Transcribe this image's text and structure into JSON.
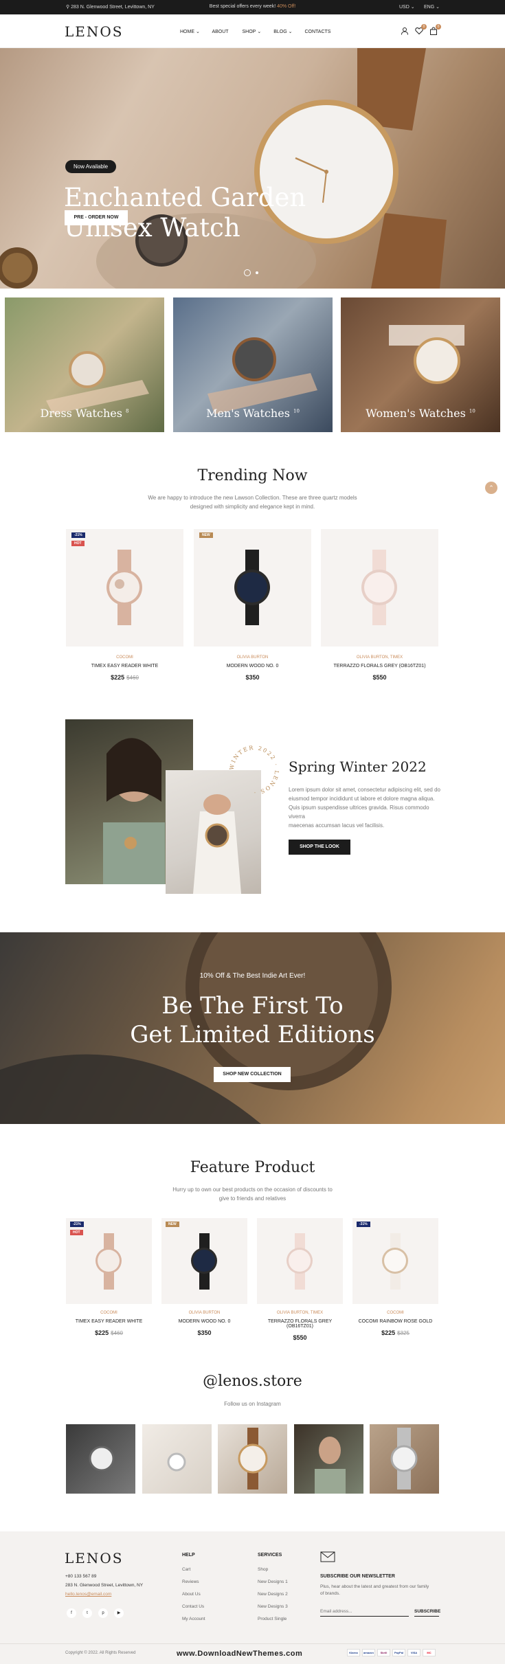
{
  "topbar": {
    "address": "283 N. Glenwood Street, Levittown, NY",
    "promo_prefix": "Best special offers every week!",
    "promo_highlight": "40% Off!",
    "currency": "USD",
    "language": "ENG"
  },
  "header": {
    "logo": "LENOS",
    "nav": [
      "HOME",
      "ABOUT",
      "SHOP",
      "BLOG",
      "CONTACTS"
    ],
    "wishlist_count": "0",
    "cart_count": "0"
  },
  "hero": {
    "badge": "Now Available",
    "title_line1": "Enchanted Garden",
    "title_line2": "Unisex Watch",
    "cta": "PRE - ORDER NOW"
  },
  "categories": [
    {
      "label": "Dress Watches",
      "count": "8"
    },
    {
      "label": "Men's Watches",
      "count": "10"
    },
    {
      "label": "Women's Watches",
      "count": "10"
    }
  ],
  "trending": {
    "title": "Trending Now",
    "subtitle_line1": "We are happy to introduce the new Lawson Collection. These are three quartz models",
    "subtitle_line2": "designed with simplicity and elegance kept in mind.",
    "products": [
      {
        "brand": "COCOMI",
        "name": "TIMEX EASY READER WHITE",
        "price": "$225",
        "old_price": "$460",
        "tags": [
          "-21%",
          "HOT"
        ]
      },
      {
        "brand": "OLIVIA BURTON",
        "name": "MODERN WOOD NO. 0",
        "price": "$350",
        "old_price": "",
        "tags": [
          "NEW"
        ]
      },
      {
        "brand": "OLIVIA BURTON, TIMEX",
        "name": "TERRAZZO FLORALS GREY (OB16TZ01)",
        "price": "$550",
        "old_price": "",
        "tags": []
      }
    ]
  },
  "spring": {
    "stamp": "WINTER 2022 · LENOS ·",
    "title": "Spring Winter 2022",
    "body_line1": "Lorem ipsum dolor sit amet, consectetur adipiscing elit, sed do",
    "body_line2": "eiusmod tempor incididunt ut labore et dolore magna aliqua.",
    "body_line3": "Quis ipsum suspendisse ultrices gravida. Risus commodo viverra",
    "body_line4": "maecenas accumsan lacus vel facilisis.",
    "cta": "SHOP THE LOOK"
  },
  "limited": {
    "kicker": "10% Off & The Best Indie Art Ever!",
    "title_line1": "Be The First To",
    "title_line2": "Get Limited Editions",
    "cta": "SHOP NEW COLLECTION"
  },
  "feature": {
    "title": "Feature Product",
    "subtitle_line1": "Hurry up to own our best products on the occasion of discounts to",
    "subtitle_line2": "give to friends and relatives",
    "products": [
      {
        "brand": "COCOMI",
        "name": "TIMEX EASY READER WHITE",
        "price": "$225",
        "old_price": "$460",
        "tags": [
          "-21%",
          "HOT"
        ]
      },
      {
        "brand": "OLIVIA BURTON",
        "name": "MODERN WOOD NO. 0",
        "price": "$350",
        "old_price": "",
        "tags": [
          "NEW"
        ]
      },
      {
        "brand": "OLIVIA BURTON, TIMEX",
        "name": "TERRAZZO FLORALS GREY (OB16TZ01)",
        "price": "$550",
        "old_price": "",
        "tags": []
      },
      {
        "brand": "COCOMI",
        "name": "COCOMI RAINBOW ROSE GOLD",
        "price": "$225",
        "old_price": "$325",
        "tags": [
          "-31%"
        ]
      }
    ]
  },
  "instagram": {
    "handle": "@lenos.store",
    "subtitle": "Follow us on Instagram"
  },
  "footer": {
    "logo": "LENOS",
    "phone": "+80 133 567 89",
    "address": "283 N. Glenwood Street, Levittown, NY",
    "email": "hello.lenos@email.com",
    "help_title": "HELP",
    "help_links": [
      "Cart",
      "Reviews",
      "About Us",
      "Contact Us",
      "My Account"
    ],
    "services_title": "SERVICES",
    "services_links": [
      "Shop",
      "New Designs 1",
      "New Designs 2",
      "New Designs 3",
      "Product Single"
    ],
    "newsletter_title": "SUBSCRIBE OUR NEWSLETTER",
    "newsletter_line1": "Plus, hear about the latest and greatest from our family",
    "newsletter_line2": "of brands.",
    "email_placeholder": "Email address...",
    "subscribe": "SUBSCRIBE",
    "copyright": "Copyright © 2022. All Rights Reserved",
    "payments": [
      "Klarna",
      "amazon",
      "Skrill",
      "PayPal",
      "VISA",
      "MC"
    ],
    "social_icons": [
      "f",
      "t",
      "p",
      "▶"
    ]
  },
  "watermark": "www.DownloadNewThemes.com",
  "colors": {
    "accent": "#c98b5a",
    "dark": "#1c1c1c",
    "light_bg": "#f6f3f1"
  }
}
